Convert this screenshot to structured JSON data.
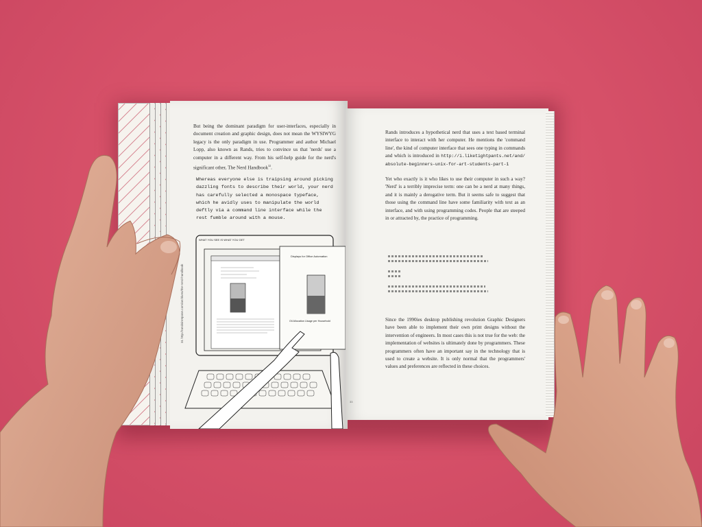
{
  "left_page": {
    "paragraph": "But being the dominant paradigm for user-interfaces, especially in document creation and graphic design, does not mean the WYSIWYG legacy is the only paradigm in use. Programmer and author Michael Lopp, also known as Rands, tries to convince us that 'nerds' use a computer in a different way. From his self-help guide for the nerd's significant other, The Nerd Handbook",
    "footnote_ref": "32",
    "quote": "Whereas everyone else is traipsing around picking dazzling fonts to describe their world, your nerd has carefully selected a monospace typeface, which he avidly uses to manipulate the world deftly via a command line interface while the rest fumble around with a mouse.",
    "running_head": "31  http://randsinrepose.com/archives/the-nerd-handbook",
    "illustration": {
      "screen_caption": "WHAT YOU SEE IS WHAT YOU GET",
      "sheet_title": "Displays for Office Automation",
      "sheet_caption": "Oil Allocation Usage per Household"
    }
  },
  "right_page": {
    "paragraph1": "Rands introduces a hypothetical nerd that uses a text based terminal interface to interact with her computer. He mentions the 'command line', the kind of computer interface that sees one typing in commands and which is introduced in",
    "url": "http://i.liketightpants.net/and/absolute-beginners-unix-for-art-students-part-1",
    "paragraph2": "Yet who exactly is it who likes to use their computer in such a way? 'Nerd' is a terribly imprecise term: one can be a nerd at many things, and it is mainly a derogative term. But it seems safe to suggest that those using the command line have some familiarity with text as an interface, and with using programming codes. People that are steeped in or attracted by, the practice of programming.",
    "paragraph3": "Since the 1990ies desktop publishing revolution Graphic Designers have been able to implement their own print designs without the intervention of engineers. In most cases this is not true for the web: the implementation of websites is ultimately done by programmers. These programmers often have an important say in the technology that is used to create a website. It is only normal that the programmers' values and preferences are reflected in these choices.",
    "page_number": "33"
  },
  "colors": {
    "surface": "#d9566c",
    "paper": "#f3f2ee",
    "ink": "#2a2a2a",
    "skin": "#d9a48a"
  }
}
